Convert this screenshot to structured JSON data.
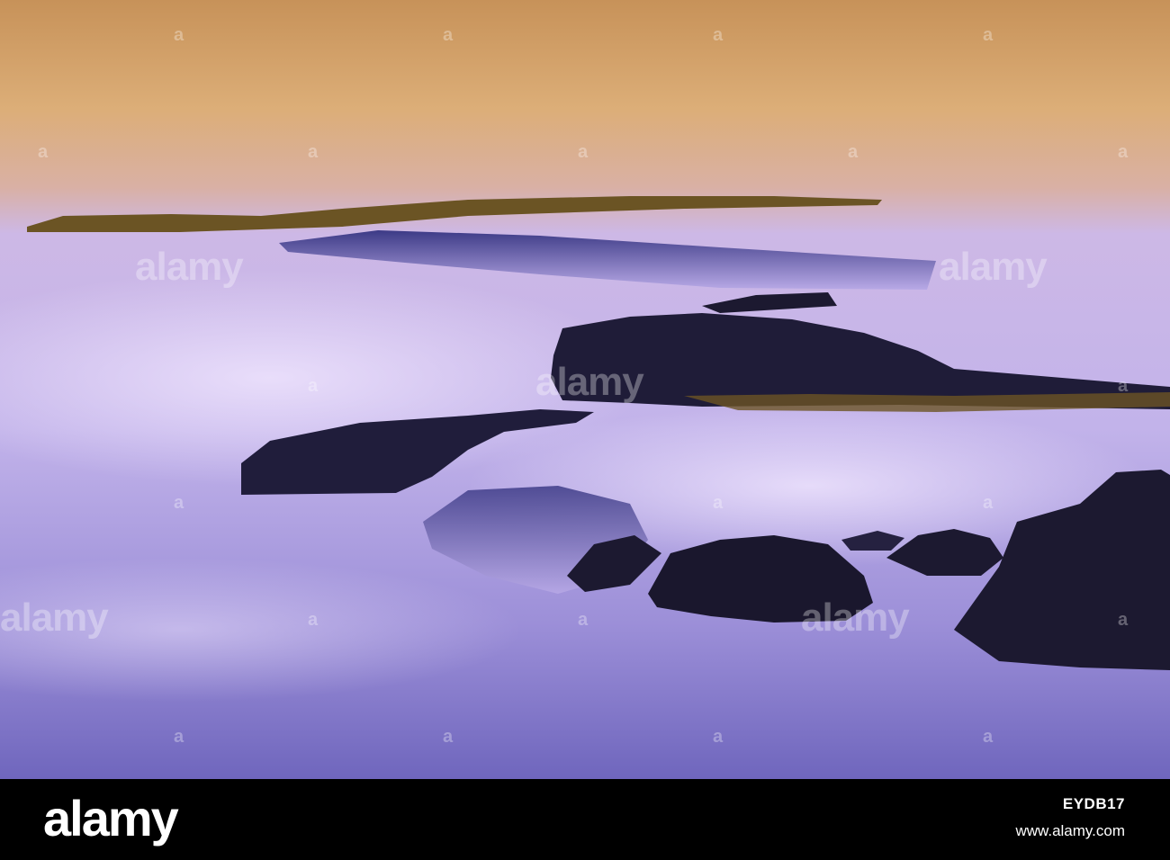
{
  "photo": {
    "subject": "long-exposure ocean water flowing over dark rock shelves at dusk",
    "colors": {
      "sky_water_gold": "#d9a56b",
      "mist_lavender": "#c9b8e8",
      "water_blue": "#5d58a8",
      "rock_dark": "#1c1930",
      "algae_brown": "#6b5424"
    }
  },
  "watermark": {
    "word": "alamy",
    "mark_icon": "alamy-a-icon"
  },
  "footer": {
    "logo": "alamy",
    "image_id": "EYDB17",
    "site": "www.alamy.com"
  }
}
